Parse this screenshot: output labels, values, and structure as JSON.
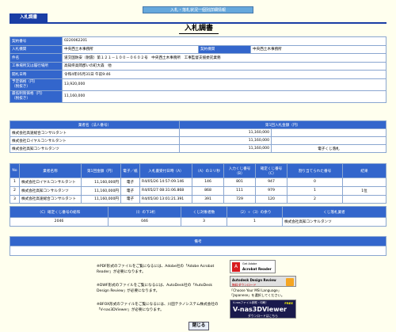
{
  "banner": "入札・落札状況一個別詳細情報",
  "tab": "入札調書",
  "title": "入札調書",
  "info": [
    {
      "label": "契約番号",
      "value": "0220062201"
    },
    {
      "label": "入札機関",
      "value": "中央西土木事務所",
      "label2": "契約機関",
      "value2": "中央西土木事務所"
    },
    {
      "label": "件名",
      "value": "道交国防安（耐震）第１２１－１００－０６０２号　中央西土木事務所　工事監督支援委託業務"
    },
    {
      "label": "工事場所又は履行場所",
      "value": "高知県高岡郡いの町大森　他"
    },
    {
      "label": "開札日時",
      "value": "令和4年05月31日 午前9:46"
    },
    {
      "label": "予定価格（円）",
      "sub": "（税抜き）",
      "value": "13,920,000"
    },
    {
      "label": "最低制限価格（円）",
      "sub": "（税抜き）",
      "value": "11,160,000"
    }
  ],
  "bidders": {
    "headers": [
      "業者名（法人番号）",
      "第1回入札金額（円）",
      ""
    ],
    "rows": [
      {
        "name": "株式会社高速総合コンサルタント",
        "amount": "11,160,000",
        "note": ""
      },
      {
        "name": "株式会社ロイヤルコンサルタント",
        "amount": "11,160,000",
        "note": ""
      },
      {
        "name": "株式会社高知コンサルタンツ",
        "amount": "11,160,000",
        "note": "電子くじ落札"
      }
    ]
  },
  "results": {
    "headers": [
      "No",
      "業者名称",
      "第1回金額（円）",
      "電子／紙",
      "入札書受付日時（A）",
      "（A）のミリ秒",
      "入力くじ番号（B）",
      "確定くじ番号（C）",
      "割り当てられた番号",
      "結果"
    ],
    "rows": [
      {
        "no": "1",
        "name": "株式会社ロイヤルコンサルタント",
        "amount": "11,160,000円",
        "type": "電子",
        "time": "R4/05/26 14:57:09.146",
        "ms": "146",
        "input": "801",
        "fixed": "947",
        "assigned": "0",
        "result": ""
      },
      {
        "no": "2",
        "name": "株式会社高知コンサルタンツ",
        "amount": "11,160,000円",
        "type": "電子",
        "time": "R4/05/27 08:31:06.868",
        "ms": "868",
        "input": "111",
        "fixed": "979",
        "assigned": "1",
        "result": "1位"
      },
      {
        "no": "3",
        "name": "株式会社高速総合コンサルタント",
        "amount": "11,160,000円",
        "type": "電子",
        "time": "R4/05/30 13:01:21.391",
        "ms": "391",
        "input": "729",
        "fixed": "120",
        "assigned": "2",
        "result": ""
      }
    ]
  },
  "lottery": {
    "headers": [
      "（C）確定くじ番号の総和",
      "（I）の下3桁",
      "くじ対象者数",
      "（2）÷（3）の余り",
      "くじ落札業者"
    ],
    "values": [
      "2046",
      "046",
      "3",
      "1",
      "株式会社高知コンサルタンツ"
    ]
  },
  "remarks": {
    "header": "備考",
    "value": ""
  },
  "notes": [
    "※PDF形式のファイルをご覧になるには、Adobe社の「Adobe Acrobat Reader」が必要になります。",
    "※DWF形式のファイルをご覧になるには、AutoDesk社の「AutoDesk Design Review」が必要になります。",
    "※BFOX形式のファイルをご覧になるには、川田テクノシステム株式会社の「V-nas3DViewer」が必要になります。"
  ],
  "badges": {
    "adobe_small": "Get Adobe",
    "adobe": "Acrobat Reader",
    "autodesk": "Autodesk Design Review",
    "autodesk_sub": "無料ダウンロード",
    "autodesk_note": "「Choose Your MSI Language」\n「Japanese」を選択してください。",
    "vnas_top": "V-nasファイル参照・印刷！",
    "vnas": "V-nas3DViewer",
    "vnas_free": "FREE",
    "vnas_sub": "ダウンロードはこちら"
  },
  "close_label": "閉じる",
  "colors": {
    "label_bg": "#3366cc",
    "page_bg": "#ffffee",
    "tab_bg": "#1a3ea5"
  }
}
